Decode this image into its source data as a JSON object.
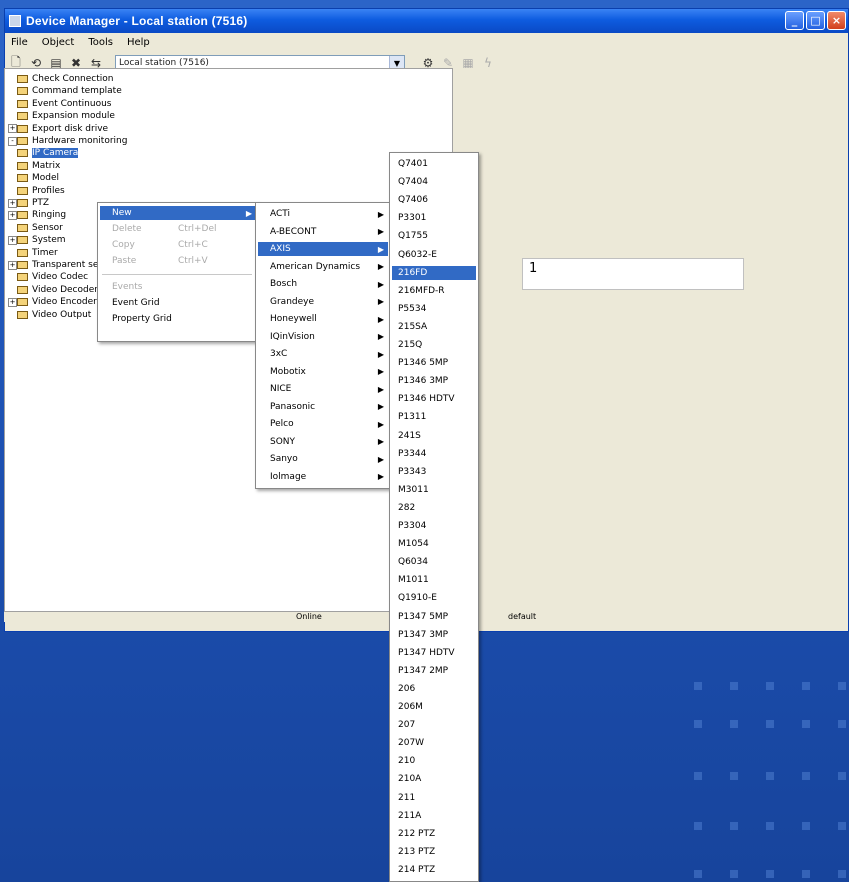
{
  "window": {
    "title": "Device Manager - Local station (7516)"
  },
  "menubar": [
    "File",
    "Object",
    "Tools",
    "Help"
  ],
  "toolbar": {
    "station_value": "Local station (7516)"
  },
  "tree": [
    {
      "label": "Check Connection"
    },
    {
      "label": "Command template"
    },
    {
      "label": "Event Continuous"
    },
    {
      "label": "Expansion module"
    },
    {
      "label": "Export disk drive",
      "exp": "+"
    },
    {
      "label": "Hardware monitoring",
      "exp": "-"
    },
    {
      "label": "IP Camera",
      "selected": true
    },
    {
      "label": "Matrix"
    },
    {
      "label": "Model"
    },
    {
      "label": "Profiles"
    },
    {
      "label": "PTZ",
      "exp": "+"
    },
    {
      "label": "Ringing",
      "exp": "+"
    },
    {
      "label": "Sensor"
    },
    {
      "label": "System",
      "exp": "+"
    },
    {
      "label": "Timer"
    },
    {
      "label": "Transparent serial",
      "exp": "+"
    },
    {
      "label": "Video Codec"
    },
    {
      "label": "Video Decoder"
    },
    {
      "label": "Video Encoder",
      "exp": "+"
    },
    {
      "label": "Video Output"
    }
  ],
  "context_menu": [
    {
      "label": "New",
      "highlight": true,
      "submenu": true
    },
    {
      "label": "Delete",
      "shortcut": "Ctrl+Del",
      "disabled": true
    },
    {
      "label": "Copy",
      "shortcut": "Ctrl+C",
      "disabled": true
    },
    {
      "label": "Paste",
      "shortcut": "Ctrl+V",
      "disabled": true
    },
    {
      "label": "Events",
      "disabled": true,
      "sep_before": true
    },
    {
      "label": "Event Grid"
    },
    {
      "label": "Property Grid"
    }
  ],
  "vendor_menu": [
    {
      "label": "ACTi"
    },
    {
      "label": "A-BECONT"
    },
    {
      "label": "AXIS",
      "highlight": true
    },
    {
      "label": "American Dynamics"
    },
    {
      "label": "Bosch"
    },
    {
      "label": "Grandeye"
    },
    {
      "label": "Honeywell"
    },
    {
      "label": "IQinVision"
    },
    {
      "label": "3xC"
    },
    {
      "label": "Mobotix"
    },
    {
      "label": "NICE"
    },
    {
      "label": "Panasonic"
    },
    {
      "label": "Pelco"
    },
    {
      "label": "SONY"
    },
    {
      "label": "Sanyo"
    },
    {
      "label": "Iolmage"
    }
  ],
  "model_menu": [
    "Q7401",
    "Q7404",
    "Q7406",
    "P3301",
    "Q1755",
    "Q6032-E",
    "216FD",
    "216MFD-R",
    "P5534",
    "215SA",
    "215Q",
    "P1346 5MP",
    "P1346 3MP",
    "P1346 HDTV",
    "P1311",
    "241S",
    "P3344",
    "P3343",
    "M3011",
    "282",
    "P3304",
    "M1054",
    "Q6034",
    "M1011",
    "Q1910-E",
    "P1347 5MP",
    "P1347 3MP",
    "P1347 HDTV",
    "P1347 2MP",
    "206",
    "206M",
    "207",
    "207W",
    "210",
    "210A",
    "211",
    "211A",
    "212 PTZ",
    "213 PTZ",
    "214 PTZ"
  ],
  "model_highlight_index": 6,
  "status": {
    "online": "Online",
    "default": "default"
  },
  "value_box": "1"
}
